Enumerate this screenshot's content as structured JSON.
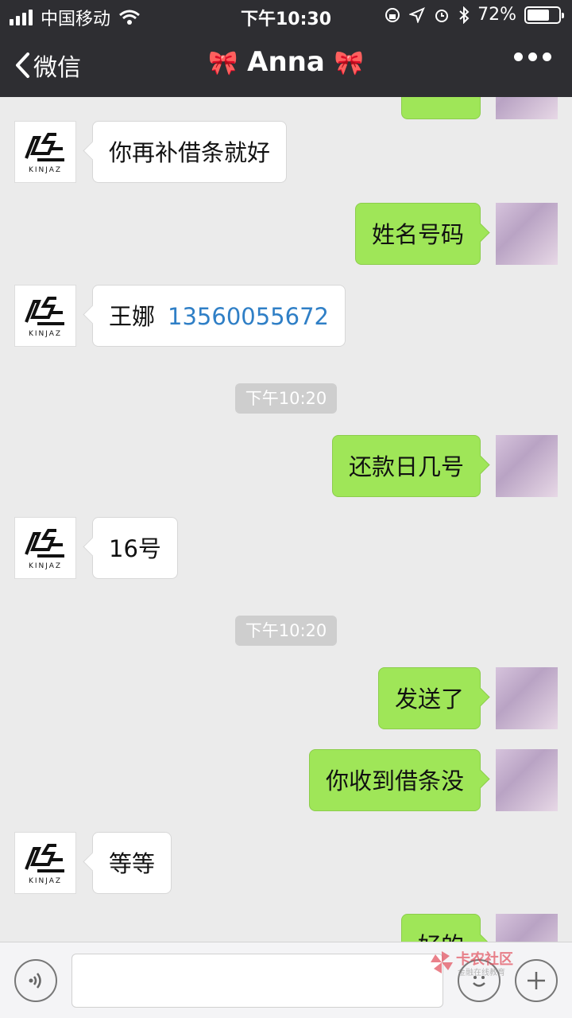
{
  "status_bar": {
    "carrier": "中国移动",
    "time": "下午10:30",
    "battery": "72%",
    "battery_level": 0.72
  },
  "nav": {
    "back_label": "微信",
    "title": "Anna",
    "title_decoration": "🎀"
  },
  "contact_avatar": {
    "brand": "KINJAZ"
  },
  "messages": [
    {
      "side": "in",
      "text": "你再补借条就好"
    },
    {
      "side": "out",
      "text": "姓名号码"
    },
    {
      "side": "in",
      "text": "王娜",
      "link": "13560055672"
    },
    {
      "type": "time",
      "text": "下午10:20"
    },
    {
      "side": "out",
      "text": "还款日几号"
    },
    {
      "side": "in",
      "text": "16号"
    },
    {
      "type": "time",
      "text": "下午10:20"
    },
    {
      "side": "out",
      "text": "发送了"
    },
    {
      "side": "out",
      "text": "你收到借条没"
    },
    {
      "side": "in",
      "text": "等等"
    },
    {
      "side": "out",
      "text": "好的"
    }
  ],
  "watermark": {
    "title": "卡农社区",
    "subtitle": "金融在线教育"
  },
  "input": {
    "placeholder": ""
  },
  "colors": {
    "nav_bg": "#2e2e32",
    "chat_bg": "#ebebeb",
    "out_bubble": "#9fe658",
    "link": "#2f7fc6"
  }
}
